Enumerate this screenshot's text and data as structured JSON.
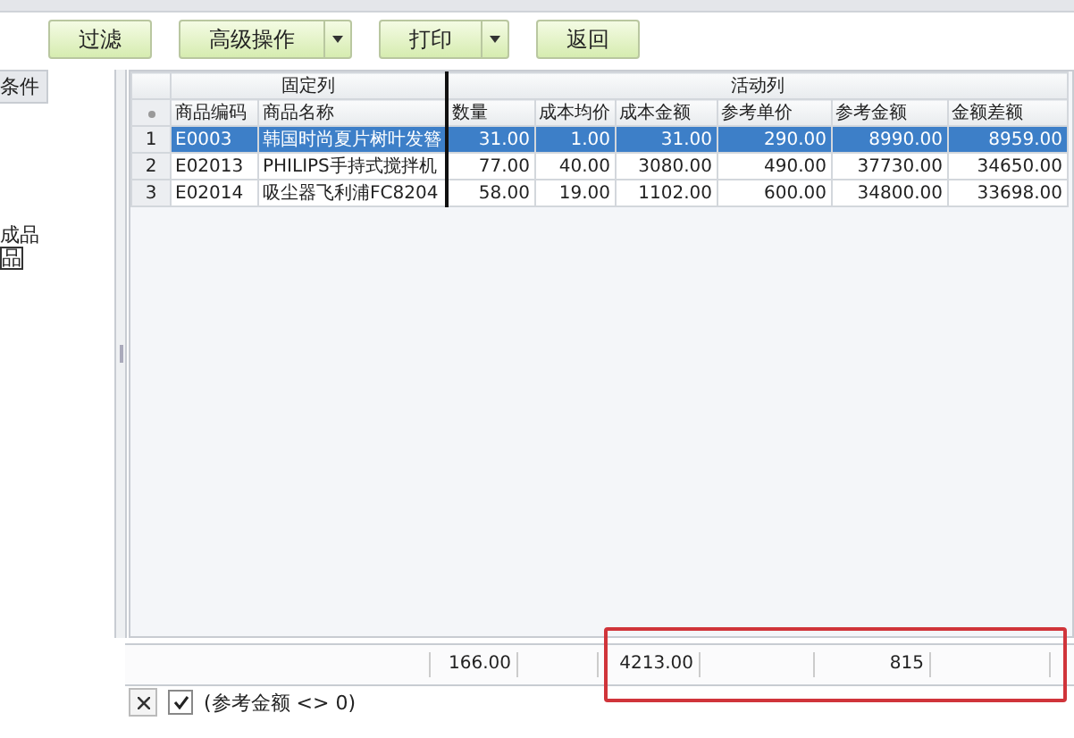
{
  "toolbar": [
    {
      "label": "过滤",
      "dropdown": false
    },
    {
      "label": "高级操作",
      "dropdown": true
    },
    {
      "label": "打印",
      "dropdown": true
    },
    {
      "label": "返回",
      "dropdown": false
    }
  ],
  "left_panel": {
    "tab": "条件",
    "lines": [
      {
        "text": "成品",
        "boxed": false
      },
      {
        "text": "品",
        "boxed": true
      }
    ]
  },
  "table": {
    "groups": [
      {
        "label": "固定列"
      },
      {
        "label": "活动列"
      }
    ],
    "columns": [
      "商品编码",
      "商品名称",
      "数量",
      "成本均价",
      "成本金额",
      "参考单价",
      "参考金额",
      "金额差额"
    ],
    "rows": [
      {
        "num": "1",
        "selected": true,
        "cells": [
          "E0003",
          "韩国时尚夏片树叶发簪",
          "31.00",
          "1.00",
          "31.00",
          "290.00",
          "8990.00",
          "8959.00"
        ]
      },
      {
        "num": "2",
        "selected": false,
        "cells": [
          "E02013",
          "PHILIPS手持式搅拌机",
          "77.00",
          "40.00",
          "3080.00",
          "490.00",
          "37730.00",
          "34650.00"
        ]
      },
      {
        "num": "3",
        "selected": false,
        "cells": [
          "E02014",
          "吸尘器飞利浦FC8204",
          "58.00",
          "19.00",
          "1102.00",
          "600.00",
          "34800.00",
          "33698.00"
        ]
      }
    ],
    "footer": {
      "quantity_total": "166.00",
      "cost_amount_total": "4213.00",
      "reference_amount_total": "815"
    }
  },
  "filter_bar": {
    "checked": true,
    "expression": "(参考金额 <> 0)"
  }
}
